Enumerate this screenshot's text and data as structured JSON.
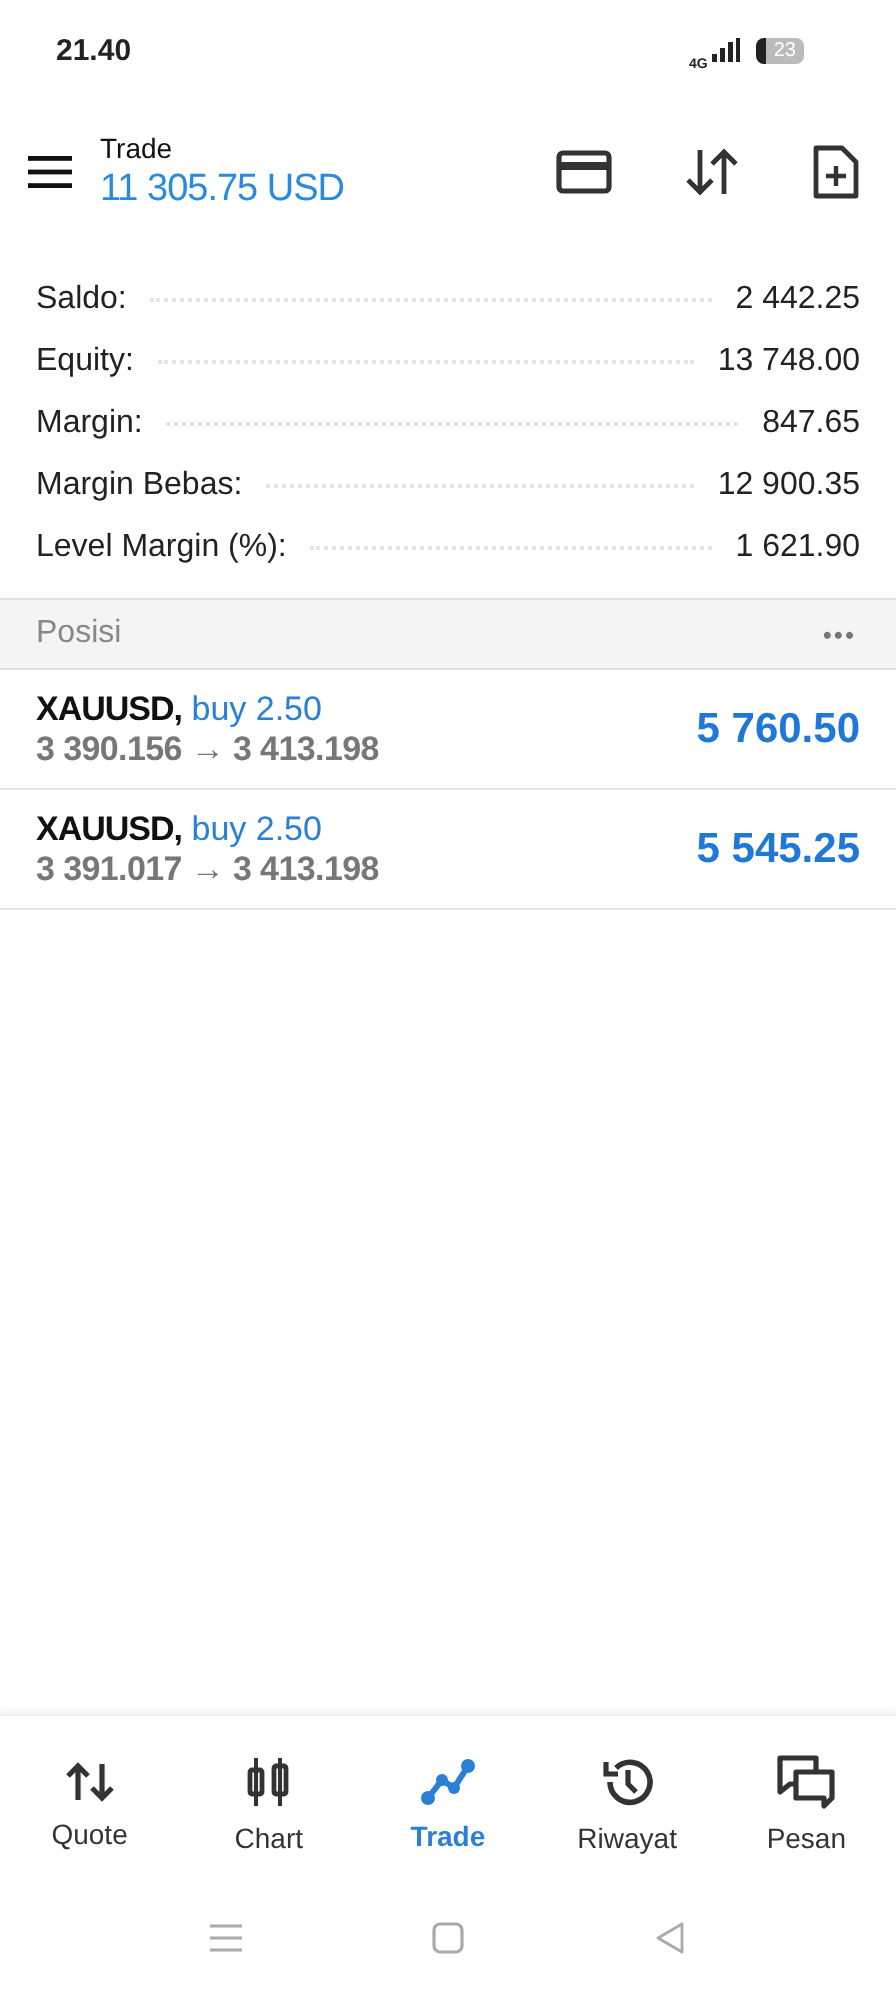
{
  "status_bar": {
    "time": "21.40",
    "network": "4G",
    "battery": "23"
  },
  "header": {
    "title": "Trade",
    "balance": "11 305.75 USD"
  },
  "summary": [
    {
      "label": "Saldo:",
      "value": "2 442.25"
    },
    {
      "label": "Equity:",
      "value": "13 748.00"
    },
    {
      "label": "Margin:",
      "value": "847.65"
    },
    {
      "label": "Margin Bebas:",
      "value": "12 900.35"
    },
    {
      "label": "Level Margin (%):",
      "value": "1 621.90"
    }
  ],
  "positions_header": {
    "title": "Posisi",
    "more": "•••"
  },
  "positions": [
    {
      "symbol": "XAUUSD,",
      "side": "buy 2.50",
      "prices": "3 390.156 → 3 413.198",
      "profit": "5 760.50"
    },
    {
      "symbol": "XAUUSD,",
      "side": "buy 2.50",
      "prices": "3 391.017 → 3 413.198",
      "profit": "5 545.25"
    }
  ],
  "tabs": [
    {
      "label": "Quote",
      "selected": false
    },
    {
      "label": "Chart",
      "selected": false
    },
    {
      "label": "Trade",
      "selected": true
    },
    {
      "label": "Riwayat",
      "selected": false
    },
    {
      "label": "Pesan",
      "selected": false
    }
  ]
}
